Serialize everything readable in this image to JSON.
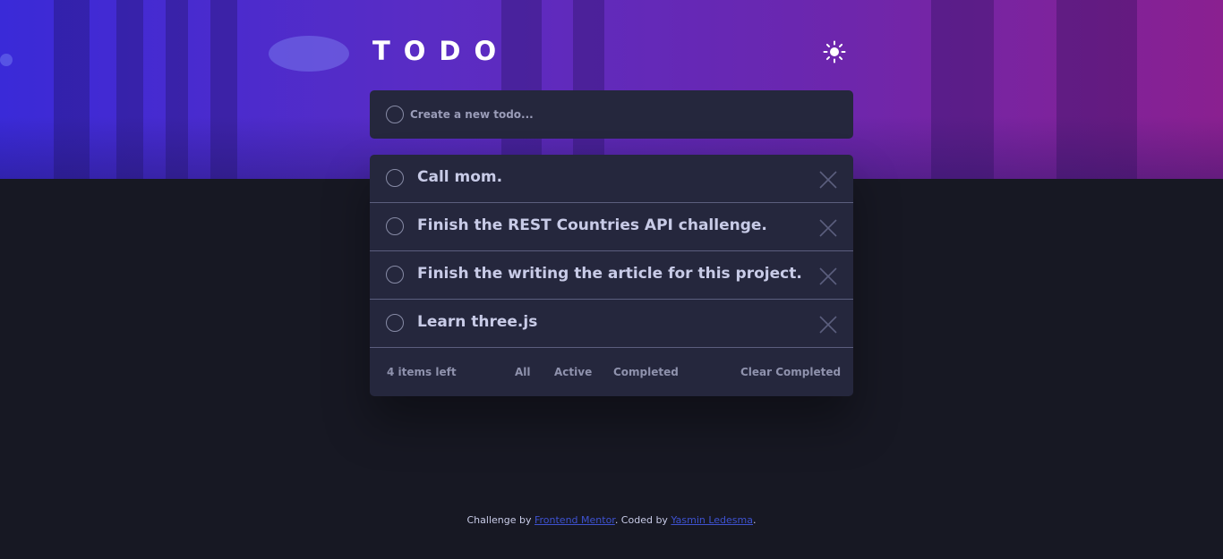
{
  "app": {
    "title": "TODO"
  },
  "header": {
    "theme_toggle_icon": "sun-icon"
  },
  "new_todo": {
    "placeholder": "Create a new todo..."
  },
  "todos": [
    {
      "text": "Call mom.",
      "completed": false
    },
    {
      "text": "Finish the REST Countries API challenge.",
      "completed": false
    },
    {
      "text": "Finish the writing the article for this project.",
      "completed": false
    },
    {
      "text": "Learn three.js",
      "completed": false
    }
  ],
  "footer": {
    "items_left": "4 items left",
    "filters": {
      "all": "All",
      "active": "Active",
      "completed": "Completed"
    },
    "clear_completed": "Clear Completed"
  },
  "credit": {
    "prefix": "Challenge by ",
    "challenge_link": "Frontend Mentor",
    "middle": ". Coded by ",
    "author_link": "Yasmin Ledesma",
    "suffix": "."
  },
  "colors": {
    "background": "#171823",
    "card": "#25273d",
    "text": "#c8cbe7",
    "muted": "#8f92ad",
    "link": "#3e52d0",
    "gradient_start": "#3a2ad8",
    "gradient_end": "#8a2090"
  }
}
